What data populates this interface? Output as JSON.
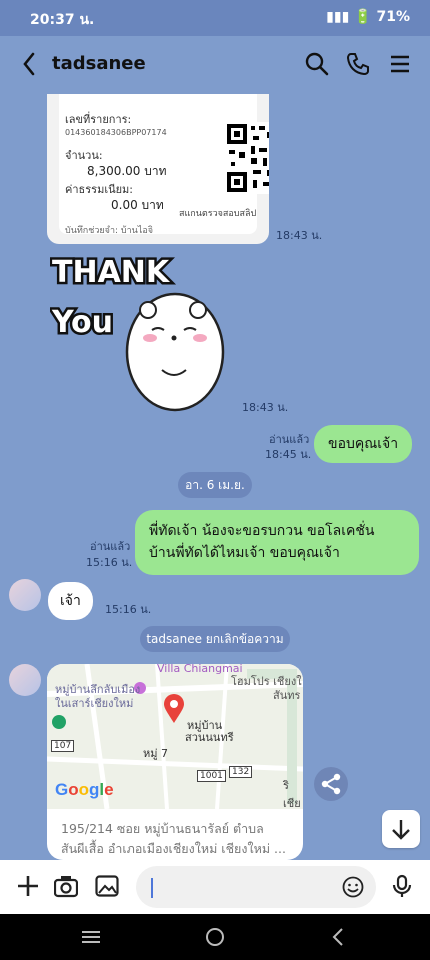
{
  "status": {
    "time": "20:37 น.",
    "battery": "71%"
  },
  "header": {
    "contact_name": "tadsanee"
  },
  "receipt": {
    "reference_label": "เลขที่รายการ:",
    "reference_value": "014360184306BPP07174",
    "amount_label": "จำนวน:",
    "amount_value": "8,300.00 บาท",
    "fee_label": "ค่าธรรมเนียม:",
    "fee_value": "0.00 บาท",
    "note_label": "บันทึกช่วยจำ: บ้านไอจิ",
    "scan_label": "สแกนตรวจสอบสลิป",
    "time": "18:43 น."
  },
  "sticker": {
    "text_line1": "THANK",
    "text_line2": "You",
    "time": "18:43 น."
  },
  "messages": {
    "msg1": {
      "text": "ขอบคุณเจ้า",
      "read": "อ่านแล้ว",
      "time": "18:45 น."
    },
    "date_divider": "อา. 6 เม.ย.",
    "msg2": {
      "line1": "พี่ทัดเจ้า น้องจะขอรบกวน ขอโลเคชั่น",
      "line2": "บ้านพี่ทัดได้ไหมเจ้า ขอบคุณเจ้า",
      "read": "อ่านแล้ว",
      "time": "15:16 น."
    },
    "msg3": {
      "text": "เจ้า",
      "time": "15:16 น."
    },
    "system_notice": "tadsanee ยกเลิกข้อความ",
    "location": {
      "map_labels": {
        "villa": "Villa Chiangmai",
        "village1": "หมู่บ้านลึกลับเมือง",
        "village2": "ในเสาร์เชียงใหม่",
        "place": "หมู่บ้าน",
        "place2": "สวนนนทรี",
        "moo": "หมู่ 7",
        "top": "โฮมโปร เชียงใ",
        "right": "สันทร",
        "r107": "107",
        "r1001": "1001",
        "r132": "132",
        "right2": "ริเชีย",
        "google": "Google"
      },
      "address_line1": "195/214 ซอย หมู่บ้านธนารัลย์ ตำบล",
      "address_line2": "สันผีเสื้อ อำเภอเมืองเชียงใหม่ เชียงใหม่ ..."
    }
  },
  "colors": {
    "chat_bg": "#7f9ccc",
    "bubble_green": "#9be691",
    "bubble_white": "#ffffff",
    "pill_bg": "#6d87bb"
  }
}
